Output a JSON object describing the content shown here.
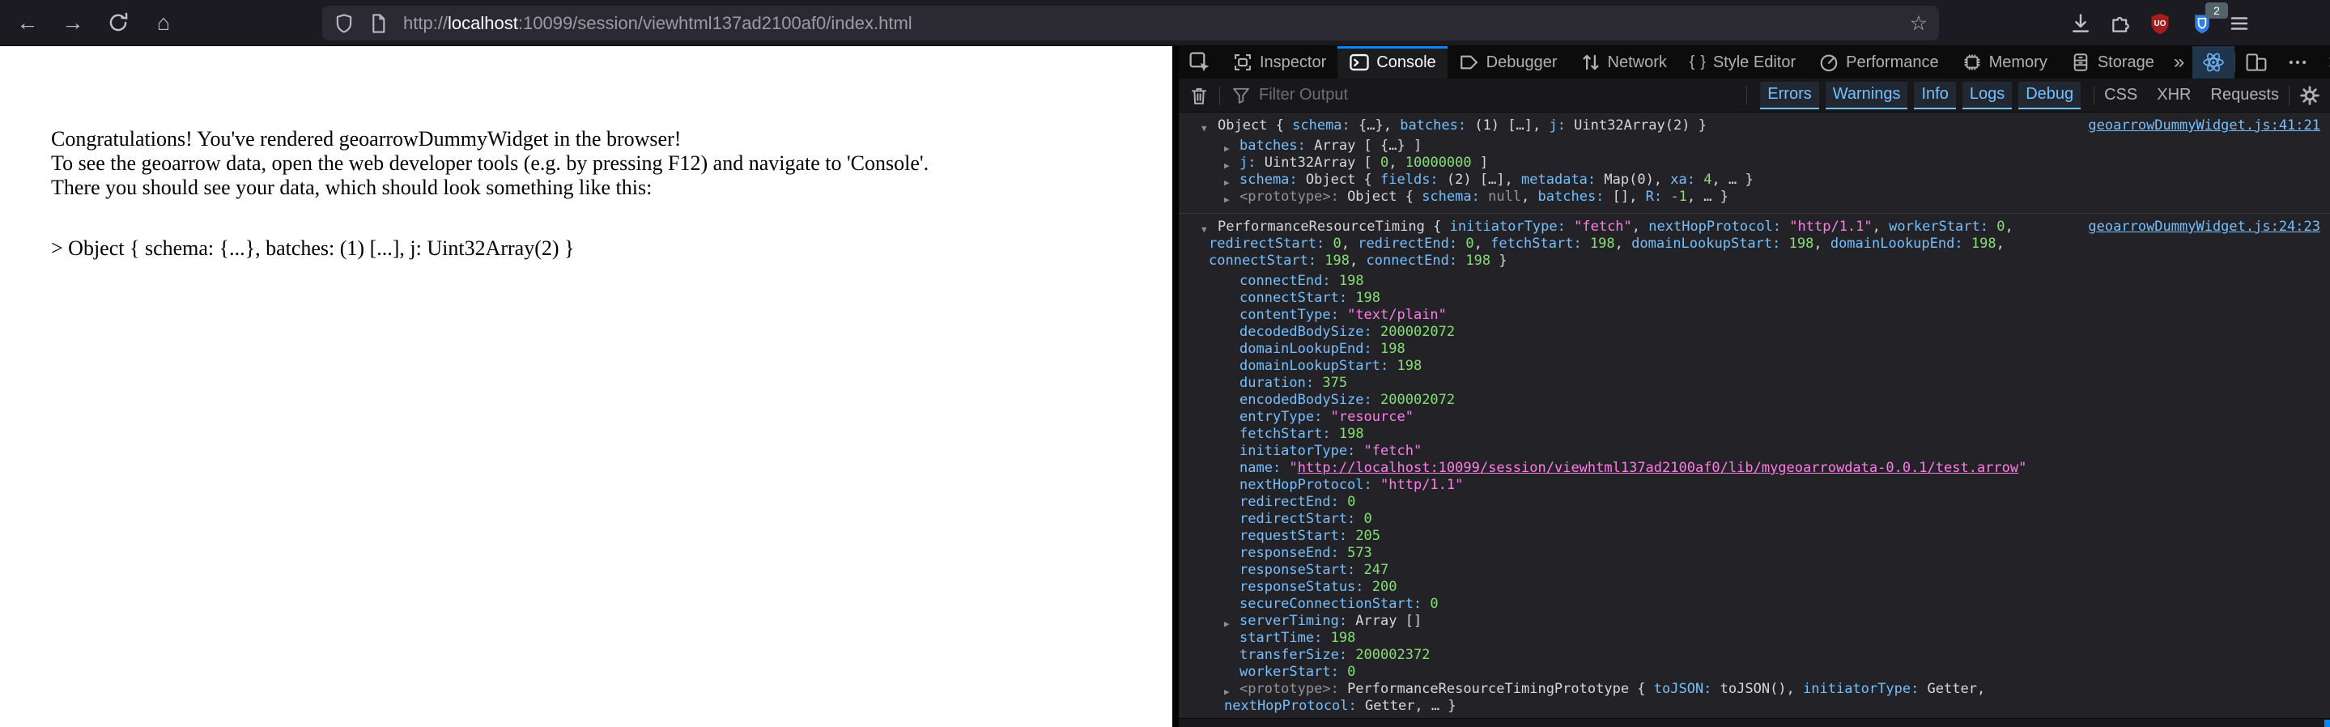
{
  "colors": {
    "accent_blue": "#0a84ff",
    "key_blue": "#75bfff",
    "number_green": "#86de74",
    "string_pink": "#ff7de9",
    "ublock_red": "#a41e1f",
    "ext_blue": "#2e7de9"
  },
  "icons": {
    "back": "←",
    "forward": "→",
    "home": "⌂",
    "star": "☆",
    "more_tabs": "»",
    "close": "×"
  },
  "browser": {
    "url_protocol": "http://",
    "url_host": "localhost",
    "url_rest": ":10099/session/viewhtml137ad2100af0/index.html",
    "ext_badge": "2"
  },
  "page": {
    "line1": "Congratulations! You've rendered geoarrowDummyWidget in the browser!",
    "line2": "To see the geoarrow data, open the web developer tools (e.g. by pressing F12) and navigate to 'Console'.",
    "line3": "There you should see your data, which should look something like this:",
    "line4": "> Object { schema: {...}, batches: (1) [...], j: Uint32Array(2) }"
  },
  "devtools": {
    "tabs": [
      "Inspector",
      "Console",
      "Debugger",
      "Network",
      "Style Editor",
      "Performance",
      "Memory",
      "Storage"
    ],
    "active_tab": "Console",
    "filter_placeholder": "Filter Output",
    "filters_active": [
      "Errors",
      "Warnings",
      "Info",
      "Logs",
      "Debug"
    ],
    "filters_inactive": [
      "CSS",
      "XHR",
      "Requests"
    ],
    "logs": [
      {
        "link": "geoarrowDummyWidget.js:41:21",
        "lines": [
          {
            "ind": 48,
            "arrow": "open",
            "aleft": 28,
            "segs": [
              [
                "p",
                "Object { "
              ],
              [
                "k",
                "schema:"
              ],
              [
                "p",
                " {…}, "
              ],
              [
                "k",
                "batches:"
              ],
              [
                "p",
                " (1) […], "
              ],
              [
                "k",
                "j:"
              ],
              [
                "p",
                " Uint32Array(2) }"
              ]
            ]
          },
          {
            "ind": 75,
            "arrow": "closed",
            "aleft": 56,
            "kid": true,
            "segs": [
              [
                "k",
                "batches:"
              ],
              [
                "p",
                " Array [ {…} ]"
              ]
            ]
          },
          {
            "ind": 75,
            "arrow": "closed",
            "aleft": 56,
            "segs": [
              [
                "k",
                "j:"
              ],
              [
                "p",
                " Uint32Array [ "
              ],
              [
                "n",
                "0"
              ],
              [
                "p",
                ", "
              ],
              [
                "n",
                "10000000"
              ],
              [
                "p",
                " ]"
              ]
            ]
          },
          {
            "ind": 75,
            "arrow": "closed",
            "aleft": 56,
            "segs": [
              [
                "k",
                "schema:"
              ],
              [
                "p",
                " Object { "
              ],
              [
                "k",
                "fields:"
              ],
              [
                "p",
                " (2) […], "
              ],
              [
                "k",
                "metadata:"
              ],
              [
                "p",
                " Map(0), "
              ],
              [
                "k",
                "xa:"
              ],
              [
                "p",
                " "
              ],
              [
                "n",
                "4"
              ],
              [
                "p",
                ", … }"
              ]
            ]
          },
          {
            "ind": 75,
            "arrow": "closed",
            "aleft": 56,
            "segs": [
              [
                "g",
                "<prototype>:"
              ],
              [
                "p",
                " Object { "
              ],
              [
                "k",
                "schema:"
              ],
              [
                "p",
                " "
              ],
              [
                "g",
                "null"
              ],
              [
                "p",
                ", "
              ],
              [
                "k",
                "batches:"
              ],
              [
                "p",
                " [], "
              ],
              [
                "k",
                "R:"
              ],
              [
                "p",
                " "
              ],
              [
                "n",
                "-1"
              ],
              [
                "p",
                ", … }"
              ]
            ]
          }
        ]
      },
      {
        "link": "geoarrowDummyWidget.js:24:23",
        "lines": [
          {
            "ind": 48,
            "arrow": "open",
            "aleft": 28,
            "segs": [
              [
                "p",
                "PerformanceResourceTiming { "
              ],
              [
                "k",
                "initiatorType:"
              ],
              [
                "p",
                " "
              ],
              [
                "s",
                "\"fetch\""
              ],
              [
                "p",
                ", "
              ],
              [
                "k",
                "nextHopProtocol:"
              ],
              [
                "p",
                " "
              ],
              [
                "s",
                "\"http/1.1\""
              ],
              [
                "p",
                ", "
              ],
              [
                "k",
                "workerStart:"
              ],
              [
                "p",
                " "
              ],
              [
                "n",
                "0"
              ],
              [
                "p",
                ","
              ]
            ]
          },
          {
            "ind": 37,
            "segs": [
              [
                "k",
                "redirectStart:"
              ],
              [
                "p",
                " "
              ],
              [
                "n",
                "0"
              ],
              [
                "p",
                ", "
              ],
              [
                "k",
                "redirectEnd:"
              ],
              [
                "p",
                " "
              ],
              [
                "n",
                "0"
              ],
              [
                "p",
                ", "
              ],
              [
                "k",
                "fetchStart:"
              ],
              [
                "p",
                " "
              ],
              [
                "n",
                "198"
              ],
              [
                "p",
                ", "
              ],
              [
                "k",
                "domainLookupStart:"
              ],
              [
                "p",
                " "
              ],
              [
                "n",
                "198"
              ],
              [
                "p",
                ", "
              ],
              [
                "k",
                "domainLookupEnd:"
              ],
              [
                "p",
                " "
              ],
              [
                "n",
                "198"
              ],
              [
                "p",
                ","
              ]
            ]
          },
          {
            "ind": 37,
            "segs": [
              [
                "k",
                "connectStart:"
              ],
              [
                "p",
                " "
              ],
              [
                "n",
                "198"
              ],
              [
                "p",
                ", "
              ],
              [
                "k",
                "connectEnd:"
              ],
              [
                "p",
                " "
              ],
              [
                "n",
                "198"
              ],
              [
                "p",
                " }"
              ]
            ]
          },
          {
            "ind": 75,
            "kid": true,
            "segs": [
              [
                "k",
                "connectEnd:"
              ],
              [
                "p",
                " "
              ],
              [
                "n",
                "198"
              ]
            ]
          },
          {
            "ind": 75,
            "segs": [
              [
                "k",
                "connectStart:"
              ],
              [
                "p",
                " "
              ],
              [
                "n",
                "198"
              ]
            ]
          },
          {
            "ind": 75,
            "segs": [
              [
                "k",
                "contentType:"
              ],
              [
                "p",
                " "
              ],
              [
                "s",
                "\"text/plain\""
              ]
            ]
          },
          {
            "ind": 75,
            "segs": [
              [
                "k",
                "decodedBodySize:"
              ],
              [
                "p",
                " "
              ],
              [
                "n",
                "200002072"
              ]
            ]
          },
          {
            "ind": 75,
            "segs": [
              [
                "k",
                "domainLookupEnd:"
              ],
              [
                "p",
                " "
              ],
              [
                "n",
                "198"
              ]
            ]
          },
          {
            "ind": 75,
            "segs": [
              [
                "k",
                "domainLookupStart:"
              ],
              [
                "p",
                " "
              ],
              [
                "n",
                "198"
              ]
            ]
          },
          {
            "ind": 75,
            "segs": [
              [
                "k",
                "duration:"
              ],
              [
                "p",
                " "
              ],
              [
                "n",
                "375"
              ]
            ]
          },
          {
            "ind": 75,
            "segs": [
              [
                "k",
                "encodedBodySize:"
              ],
              [
                "p",
                " "
              ],
              [
                "n",
                "200002072"
              ]
            ]
          },
          {
            "ind": 75,
            "segs": [
              [
                "k",
                "entryType:"
              ],
              [
                "p",
                " "
              ],
              [
                "s",
                "\"resource\""
              ]
            ]
          },
          {
            "ind": 75,
            "segs": [
              [
                "k",
                "fetchStart:"
              ],
              [
                "p",
                " "
              ],
              [
                "n",
                "198"
              ]
            ]
          },
          {
            "ind": 75,
            "segs": [
              [
                "k",
                "initiatorType:"
              ],
              [
                "p",
                " "
              ],
              [
                "s",
                "\"fetch\""
              ]
            ]
          },
          {
            "ind": 75,
            "segs": [
              [
                "k",
                "name:"
              ],
              [
                "p",
                " "
              ],
              [
                "s",
                "\""
              ],
              [
                "u",
                "http://localhost:10099/session/viewhtml137ad2100af0/lib/mygeoarrowdata-0.0.1/test.arrow"
              ],
              [
                "s",
                "\""
              ]
            ]
          },
          {
            "ind": 75,
            "segs": [
              [
                "k",
                "nextHopProtocol:"
              ],
              [
                "p",
                " "
              ],
              [
                "s",
                "\"http/1.1\""
              ]
            ]
          },
          {
            "ind": 75,
            "segs": [
              [
                "k",
                "redirectEnd:"
              ],
              [
                "p",
                " "
              ],
              [
                "n",
                "0"
              ]
            ]
          },
          {
            "ind": 75,
            "segs": [
              [
                "k",
                "redirectStart:"
              ],
              [
                "p",
                " "
              ],
              [
                "n",
                "0"
              ]
            ]
          },
          {
            "ind": 75,
            "segs": [
              [
                "k",
                "requestStart:"
              ],
              [
                "p",
                " "
              ],
              [
                "n",
                "205"
              ]
            ]
          },
          {
            "ind": 75,
            "segs": [
              [
                "k",
                "responseEnd:"
              ],
              [
                "p",
                " "
              ],
              [
                "n",
                "573"
              ]
            ]
          },
          {
            "ind": 75,
            "segs": [
              [
                "k",
                "responseStart:"
              ],
              [
                "p",
                " "
              ],
              [
                "n",
                "247"
              ]
            ]
          },
          {
            "ind": 75,
            "segs": [
              [
                "k",
                "responseStatus:"
              ],
              [
                "p",
                " "
              ],
              [
                "n",
                "200"
              ]
            ]
          },
          {
            "ind": 75,
            "segs": [
              [
                "k",
                "secureConnectionStart:"
              ],
              [
                "p",
                " "
              ],
              [
                "n",
                "0"
              ]
            ]
          },
          {
            "ind": 75,
            "arrow": "closed",
            "aleft": 56,
            "segs": [
              [
                "k",
                "serverTiming:"
              ],
              [
                "p",
                " Array []"
              ]
            ]
          },
          {
            "ind": 75,
            "segs": [
              [
                "k",
                "startTime:"
              ],
              [
                "p",
                " "
              ],
              [
                "n",
                "198"
              ]
            ]
          },
          {
            "ind": 75,
            "segs": [
              [
                "k",
                "transferSize:"
              ],
              [
                "p",
                " "
              ],
              [
                "n",
                "200002372"
              ]
            ]
          },
          {
            "ind": 75,
            "segs": [
              [
                "k",
                "workerStart:"
              ],
              [
                "p",
                " "
              ],
              [
                "n",
                "0"
              ]
            ]
          },
          {
            "ind": 75,
            "arrow": "closed",
            "aleft": 56,
            "segs": [
              [
                "g",
                "<prototype>:"
              ],
              [
                "p",
                " PerformanceResourceTimingPrototype { "
              ],
              [
                "k",
                "toJSON:"
              ],
              [
                "p",
                " toJSON(), "
              ],
              [
                "k",
                "initiatorType:"
              ],
              [
                "p",
                " Getter,"
              ]
            ]
          },
          {
            "ind": 56,
            "segs": [
              [
                "k",
                "nextHopProtocol:"
              ],
              [
                "p",
                " Getter, … }"
              ]
            ]
          }
        ]
      }
    ]
  }
}
